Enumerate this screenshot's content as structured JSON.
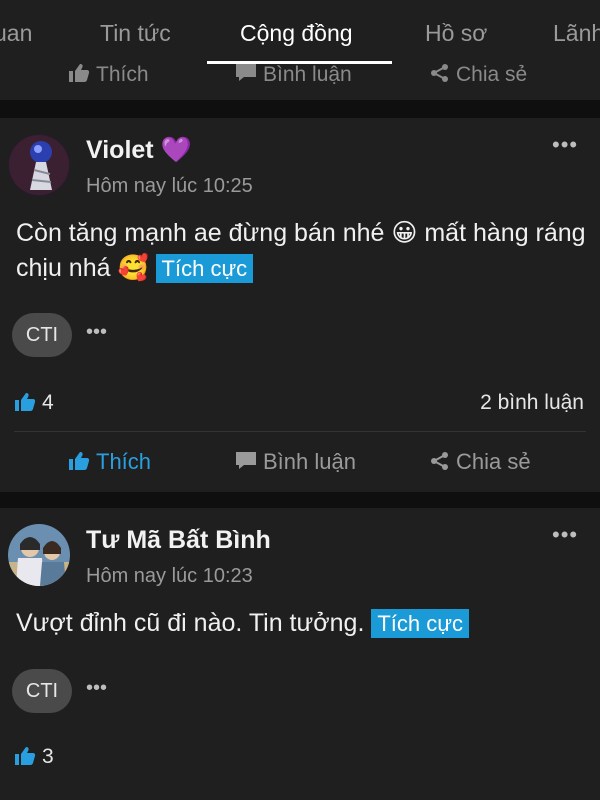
{
  "tabs": [
    "uan",
    "Tin tức",
    "Cộng đồng",
    "Hồ sơ",
    "Lãnh"
  ],
  "prev_post": {
    "like_label": "Thích",
    "comment_label": "Bình luận",
    "share_label": "Chia sẻ"
  },
  "posts": [
    {
      "author": "Violet 💜",
      "time": "Hôm nay lúc 10:25",
      "text": "Còn tăng mạnh ae đừng bán nhé 😀 mất hàng ráng chịu nhá 🥰",
      "sentiment": "Tích cực",
      "ticker": "CTI",
      "likes": "4",
      "comments": "2 bình luận",
      "like_label": "Thích",
      "comment_label": "Bình luận",
      "share_label": "Chia sẻ"
    },
    {
      "author": "Tư Mã Bất Bình",
      "time": "Hôm nay lúc 10:23",
      "text": "Vượt đỉnh cũ đi nào. Tin tưởng.",
      "sentiment": "Tích cực",
      "ticker": "CTI",
      "likes": "3"
    }
  ],
  "colors": {
    "accent": "#1a9ad6",
    "like_active": "#2a9fe0",
    "background": "#121212",
    "card": "#1f1f1f"
  },
  "icons": [
    "thumbs-up-icon",
    "comment-icon",
    "share-icon",
    "more-dots-icon"
  ]
}
